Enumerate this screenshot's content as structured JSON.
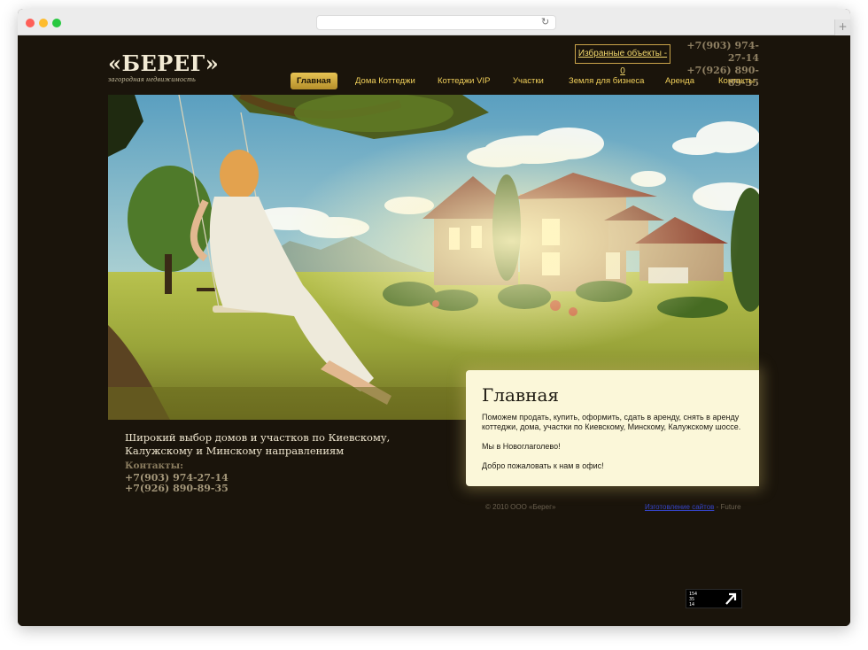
{
  "browser": {
    "url": "",
    "reload_icon": "reload-icon",
    "new_tab_label": "+"
  },
  "header": {
    "logo_title": "«БЕРЕГ»",
    "logo_subtitle": "загородная недвижимость",
    "favorites_label": "Избранные объекты - 0",
    "phone_1": "+7(903) 974-27-14",
    "phone_2": "+7(926) 890-89-35"
  },
  "nav": {
    "items": [
      {
        "label": "Главная",
        "active": true
      },
      {
        "label": "Дома Коттеджи",
        "active": false
      },
      {
        "label": "Коттеджи VIP",
        "active": false
      },
      {
        "label": "Участки",
        "active": false
      },
      {
        "label": "Земля для бизнеса",
        "active": false
      },
      {
        "label": "Аренда",
        "active": false
      },
      {
        "label": "Контакты",
        "active": false
      }
    ]
  },
  "content": {
    "title": "Главная",
    "paragraph_1": "Поможем продать, купить, оформить, сдать в аренду, снять в аренду коттеджи, дома, участки по Киевскому, Минскому, Калужскому шоссе.",
    "paragraph_2": "Мы в Новоглаголево!",
    "paragraph_3": "Добро пожаловать к нам в офис!"
  },
  "footer": {
    "tagline": "Широкий выбор домов и участков по Киевскому, Калужскому и Минскому направлениям",
    "contacts_label": "Контакты:",
    "phone_1": "+7(903) 974-27-14",
    "phone_2": "+7(926) 890-89-35",
    "copyright": "© 2010 ООО «Берег»",
    "credits_link": "Изготовление сайтов",
    "credits_suffix": " - Future"
  },
  "counter": {
    "line_1": "154",
    "line_2": "35",
    "line_3": "14",
    "icon": "arrow-up-right-icon"
  },
  "colors": {
    "page_background": "#1a140b",
    "accent_gold": "#f0cf5a",
    "card_background": "#fbf7d9"
  }
}
